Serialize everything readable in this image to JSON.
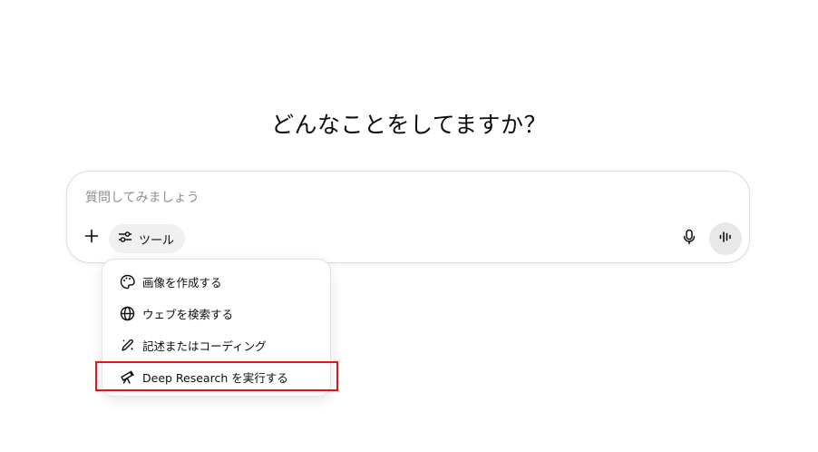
{
  "main": {
    "heading": "どんなことをしてますか？"
  },
  "composer": {
    "placeholder": "質問してみましょう",
    "tools_label": "ツール",
    "icons": {
      "plus": "plus-icon",
      "tools": "sliders-icon",
      "mic": "microphone-icon",
      "voice": "voice-waveform-icon"
    }
  },
  "tools_menu": {
    "items": [
      {
        "label": "画像を作成する",
        "icon": "palette-icon"
      },
      {
        "label": "ウェブを検索する",
        "icon": "globe-icon"
      },
      {
        "label": "記述またはコーディング",
        "icon": "pen-sparkle-icon"
      },
      {
        "label": "Deep Research を実行する",
        "icon": "telescope-icon"
      }
    ]
  },
  "annotation": {
    "highlight_color": "#e0161e"
  }
}
